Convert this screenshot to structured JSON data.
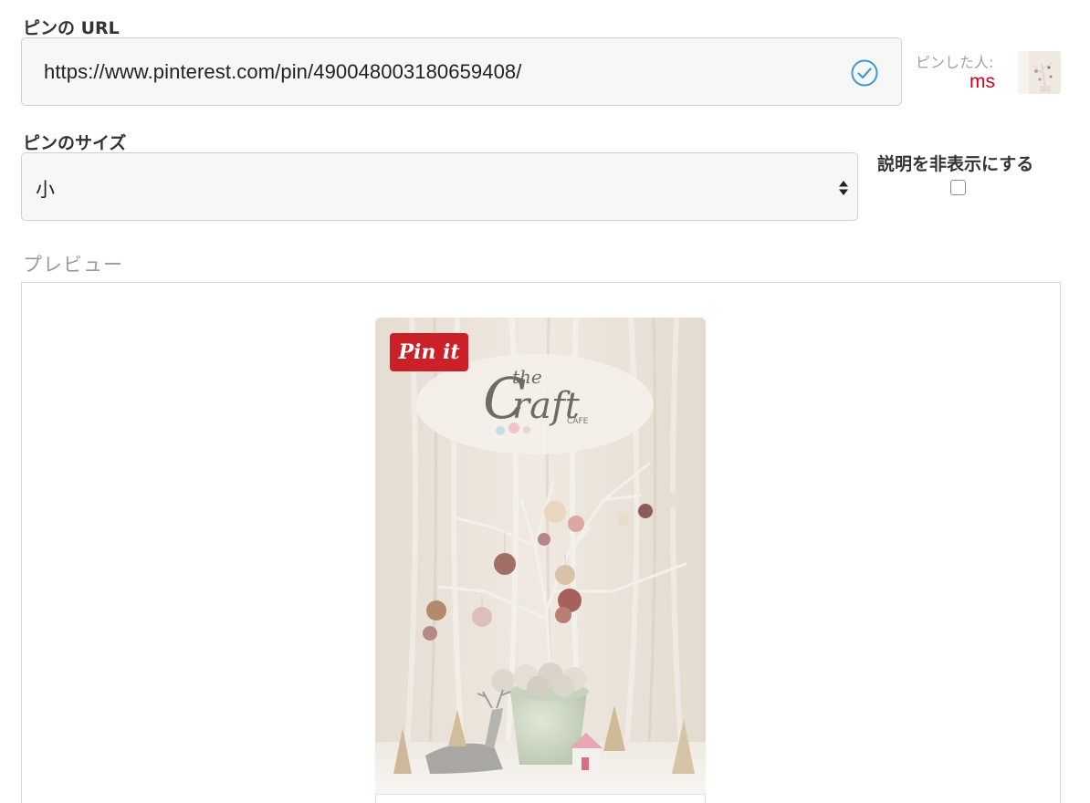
{
  "url_section": {
    "label": "ピンの URL",
    "value": "https://www.pinterest.com/pin/490048003180659408/",
    "valid_icon": "check-circle-icon"
  },
  "pinner": {
    "label": "ピンした人:",
    "name": "ms",
    "name_color": "#d0021b"
  },
  "size_section": {
    "label": "ピンのサイズ",
    "selected": "小"
  },
  "hide_description": {
    "label": "説明を非表示にする",
    "checked": false
  },
  "preview": {
    "label": "プレビュー",
    "pin_button_label": "Pin it",
    "pin_button_color": "#cb2027",
    "logo_text": "the Craft CAFE"
  },
  "colors": {
    "accent_check": "#3d9ad1",
    "input_bg": "#f7f7f7",
    "border": "#cfcfcf"
  }
}
